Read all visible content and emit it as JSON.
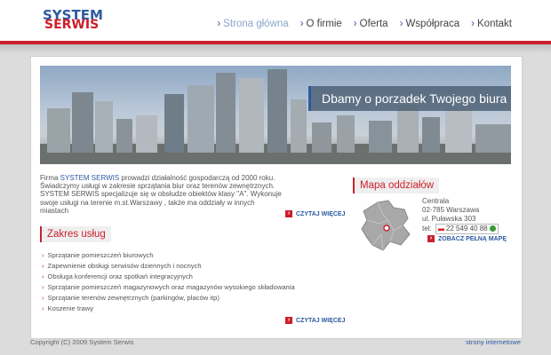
{
  "logo": {
    "line1": "SYSTEM",
    "line2": "SERWIS"
  },
  "nav": {
    "items": [
      {
        "label": "Strona główna"
      },
      {
        "label": "O firmie"
      },
      {
        "label": "Oferta"
      },
      {
        "label": "Współpraca"
      },
      {
        "label": "Kontakt"
      }
    ]
  },
  "banner": {
    "caption": "Dbamy o porzadek Twojego biura"
  },
  "intro": {
    "prefix": "Firma ",
    "brand": "SYSTEM SERWIS",
    "text1": " prowadzi działalność gospodarczą od 2000 roku. Świadczymy usługi w zakresie sprzątania biur oraz terenów zewnętrznych.",
    "text2": "SYSTEM SERWIS specjalizuje się w obsłudze obiektów klasy \"A\". Wykonuje swoje usługi na terenie m.st.Warszawy , także ma oddziały w innych miastach",
    "more": "CZYTAJ WIĘCEJ"
  },
  "services": {
    "title": "Zakres usług",
    "items": [
      "Sprzątanie pomieszczeń biurowych",
      "Zapewnienie obsługi serwisów dziennych i nocnych",
      "Obsługa konferencji oraz spotkań integracyjnych",
      "Sprzątanie pomieszczeń magazynowych oraz magazynów wysokiego składowania",
      "Sprzątanie terenów zewnętrznych (parkingów, placów itp)",
      "Koszenie trawy"
    ],
    "more": "CZYTAJ WIĘCEJ"
  },
  "map": {
    "title": "Mapa oddziałów",
    "name": "Centrala",
    "postal": "02-785 Warszawa",
    "street": "ul. Puławska 303",
    "tel_label": "tel:",
    "phone": "22 549 40 88",
    "button": "ZOBACZ PEŁNĄ MAPĘ"
  },
  "footer": {
    "copyright": "Copyright (C) 2009 System Serwis",
    "link": "strony internetowe"
  },
  "colors": {
    "accent_red": "#cc1f2b",
    "brand_blue": "#2c5aa0"
  }
}
